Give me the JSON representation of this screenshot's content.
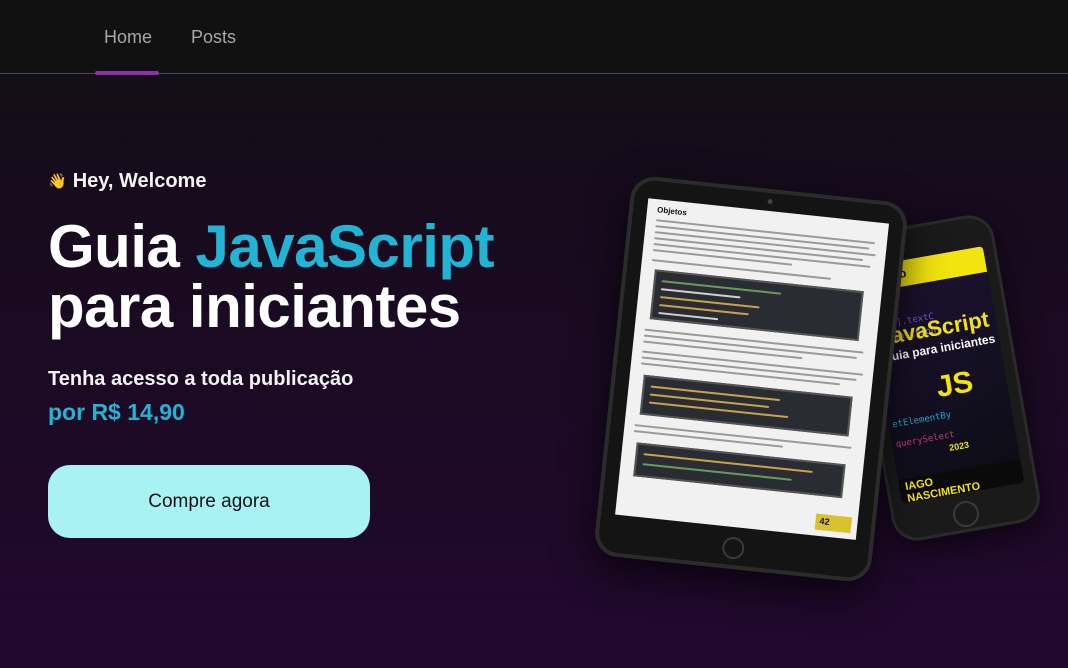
{
  "nav": {
    "items": [
      {
        "label": "Home"
      },
      {
        "label": "Posts"
      }
    ]
  },
  "hero": {
    "greeting": "Hey, Welcome",
    "headline_part1": "Guia ",
    "headline_accent": "JavaScript",
    "headline_part2": "para iniciantes",
    "subtitle": "Tenha acesso a toda publicação",
    "price": "por R$ 14,90",
    "cta_label": "Compre agora"
  },
  "book": {
    "banner": "mação",
    "title": "JavaScript",
    "subtitle": "Guia para iniciantes",
    "badge": "JS",
    "year": "2023",
    "author_first": "IAGO",
    "author_last": "NASCIMENTO"
  },
  "tablet_page": {
    "heading": "Objetos",
    "page_number": "42"
  },
  "colors": {
    "accent": "#22b4d4",
    "cta_bg": "#a9f2f4",
    "nav_indicator": "#8e2fa8",
    "book_yellow": "#f2e40f"
  },
  "icons": {
    "greeting": "waving-hand-icon"
  }
}
